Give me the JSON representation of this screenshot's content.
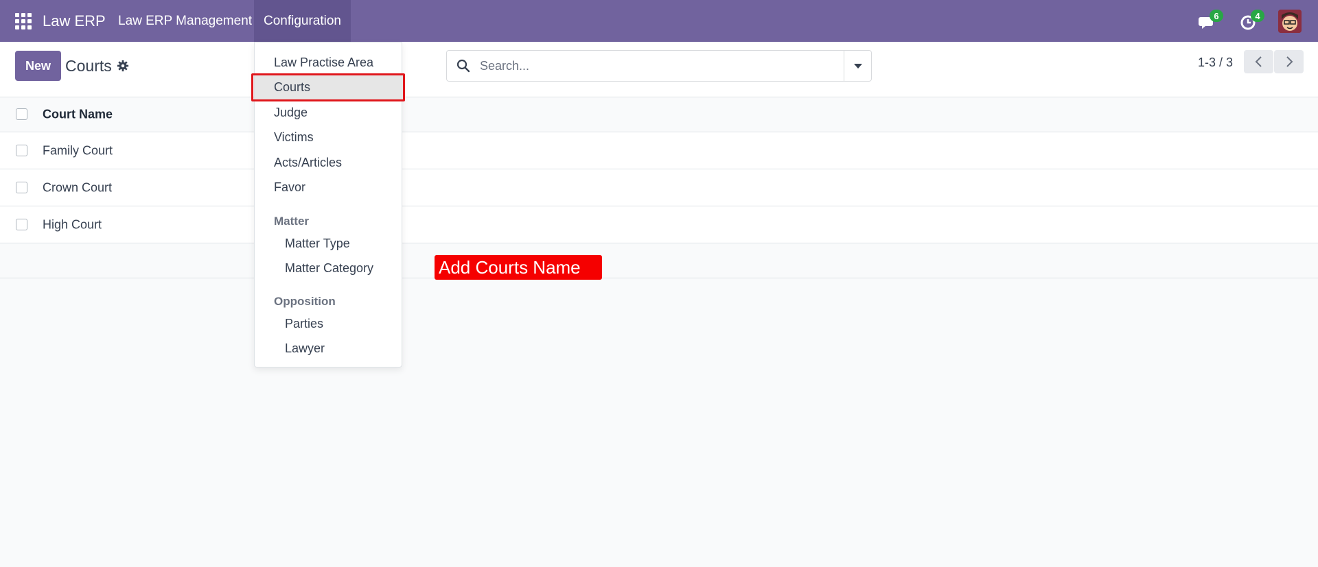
{
  "navbar": {
    "brand": "Law ERP",
    "menu_items": [
      "Law ERP Management",
      "Configuration"
    ],
    "messages_count": "6",
    "activities_count": "4",
    "bg_color": "#71639e"
  },
  "control_panel": {
    "new_label": "New",
    "title": "Courts",
    "search_placeholder": "Search...",
    "pager_value": "1-3 / 3"
  },
  "list": {
    "column_header": "Court Name",
    "rows": [
      "Family Court",
      "Crown Court",
      "High Court"
    ]
  },
  "dropdown": {
    "items": [
      "Law Practise Area",
      "Courts",
      "Judge",
      "Victims",
      "Acts/Articles",
      "Favor"
    ],
    "active_item": "Courts",
    "sections": [
      {
        "title": "Matter",
        "items": [
          "Matter Type",
          "Matter Category"
        ]
      },
      {
        "title": "Opposition",
        "items": [
          "Parties",
          "Lawyer"
        ]
      }
    ]
  },
  "annotation": {
    "text": "Add Courts Name",
    "color": "#f50000"
  }
}
